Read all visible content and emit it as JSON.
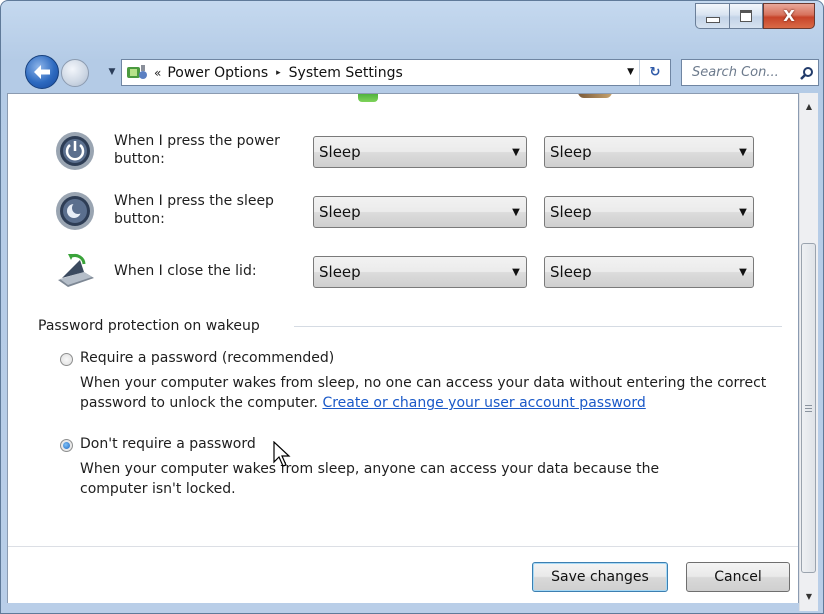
{
  "window": {
    "caption_buttons": {
      "minimize_icon": "minimize-icon",
      "maximize_icon": "maximize-icon",
      "close_icon": "close-icon",
      "close_glyph": "X"
    }
  },
  "address_bar": {
    "overflow_chevron": "«",
    "breadcrumbs": [
      "Power Options",
      "System Settings"
    ],
    "separator_glyph": "▸",
    "dropdown_glyph": "▼",
    "refresh_glyph": "↻"
  },
  "search": {
    "placeholder": "Search Con..."
  },
  "power_rows": [
    {
      "label": "When I press the power button:",
      "icon": "power-button-icon",
      "on_battery": "Sleep",
      "plugged_in": "Sleep"
    },
    {
      "label": "When I press the sleep button:",
      "icon": "sleep-button-icon",
      "on_battery": "Sleep",
      "plugged_in": "Sleep"
    },
    {
      "label": "When I close the lid:",
      "icon": "laptop-lid-icon",
      "on_battery": "Sleep",
      "plugged_in": "Sleep"
    }
  ],
  "password_section": {
    "title": "Password protection on wakeup",
    "options": [
      {
        "label": "Require a password (recommended)",
        "selected": false,
        "description": "When your computer wakes from sleep, no one can access your data without entering the correct password to unlock the computer.",
        "link": "Create or change your user account password"
      },
      {
        "label": "Don't require a password",
        "selected": true,
        "description": "When your computer wakes from sleep, anyone can access your data because the computer isn't locked."
      }
    ]
  },
  "buttons": {
    "save": "Save changes",
    "cancel": "Cancel"
  },
  "colors": {
    "link": "#1a59c8",
    "frame": "#b9cee8",
    "close_button": "#c7442a"
  }
}
